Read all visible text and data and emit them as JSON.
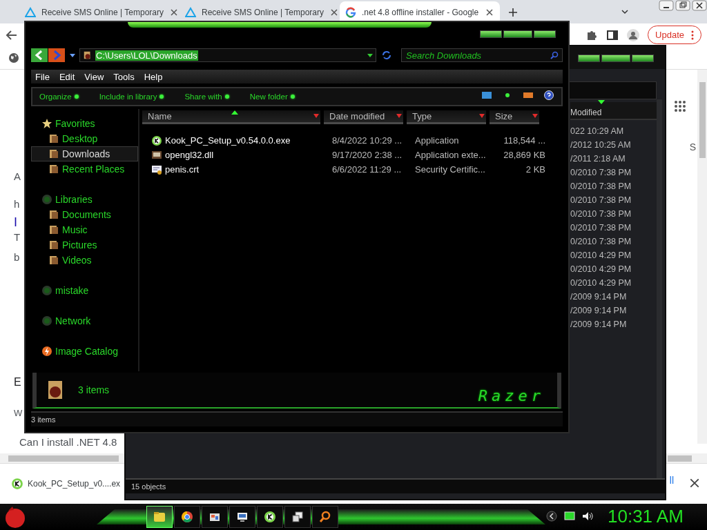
{
  "browser": {
    "tabs": [
      {
        "title": "Receive SMS Online | Temporary",
        "kind": "triangle",
        "selected": false
      },
      {
        "title": "Receive SMS Online | Temporary",
        "kind": "triangle",
        "selected": false
      },
      {
        "title": ".net 4.8 offline installer - Google",
        "kind": "google",
        "selected": true
      }
    ],
    "update_button": "Update",
    "page_lines": [
      {
        "text": "A",
        "kind": "text"
      },
      {
        "text": "h",
        "kind": "text"
      },
      {
        "text": "I",
        "kind": "link"
      },
      {
        "text": "T",
        "kind": "text"
      },
      {
        "text": "b",
        "kind": "text"
      },
      {
        "text": "E",
        "kind": "heading"
      },
      {
        "text": "W",
        "kind": "text"
      },
      {
        "text": "Can I install .NET 4.8",
        "kind": "text"
      }
    ],
    "side_fragment": "S",
    "download": {
      "filename": "Kook_PC_Setup_v0....ex",
      "button": "ll"
    }
  },
  "back_window": {
    "column": "Modified",
    "rows": [
      "022 10:29 AM",
      "/2012 10:25 AM",
      "/2011 2:18 AM",
      "0/2010 7:38 PM",
      "0/2010 7:38 PM",
      "0/2010 7:38 PM",
      "0/2010 7:38 PM",
      "0/2010 7:38 PM",
      "0/2010 7:38 PM",
      "0/2010 4:29 PM",
      "0/2010 4:29 PM",
      "0/2010 4:29 PM",
      "/2009 9:14 PM",
      "/2009 9:14 PM",
      "/2009 9:14 PM"
    ],
    "status": "15 objects"
  },
  "explorer": {
    "address": "C:\\Users\\LOL\\Downloads",
    "search": {
      "placeholder": "Search Downloads"
    },
    "menu": [
      "File",
      "Edit",
      "View",
      "Tools",
      "Help"
    ],
    "commands": [
      "Organize",
      "Include in library",
      "Share with",
      "New folder"
    ],
    "sidebar": [
      {
        "label": "Favorites",
        "kind": "star",
        "selected": false,
        "children": [
          {
            "label": "Desktop",
            "kind": "folder",
            "selected": false
          },
          {
            "label": "Downloads",
            "kind": "folder",
            "selected": true
          },
          {
            "label": "Recent Places",
            "kind": "folder",
            "selected": false
          }
        ]
      },
      {
        "label": "Libraries",
        "kind": "disc",
        "selected": false,
        "children": [
          {
            "label": "Documents",
            "kind": "folder",
            "selected": false
          },
          {
            "label": "Music",
            "kind": "folder",
            "selected": false
          },
          {
            "label": "Pictures",
            "kind": "folder",
            "selected": false
          },
          {
            "label": "Videos",
            "kind": "folder",
            "selected": false
          }
        ]
      },
      {
        "label": "mistake",
        "kind": "disc",
        "selected": false
      },
      {
        "label": "Network",
        "kind": "disc",
        "selected": false
      },
      {
        "label": "Image Catalog",
        "kind": "bolt",
        "selected": false
      }
    ],
    "columns": [
      {
        "label": "Name",
        "sorted": true
      },
      {
        "label": "Date modified",
        "sorted": false
      },
      {
        "label": "Type",
        "sorted": false
      },
      {
        "label": "Size",
        "sorted": false
      }
    ],
    "files": [
      {
        "name": "Kook_PC_Setup_v0.54.0.0.exe",
        "date": "8/4/2022 10:29 ...",
        "type": "Application",
        "size": "118,544 ...",
        "kind": "app"
      },
      {
        "name": "opengl32.dll",
        "date": "9/17/2020 2:38 ...",
        "type": "Application exte...",
        "size": "28,869 KB",
        "kind": "dll"
      },
      {
        "name": "penis.crt",
        "date": "6/6/2022 11:29 ...",
        "type": "Security Certific...",
        "size": "2 KB",
        "kind": "cert"
      }
    ],
    "details": {
      "count": "3 items",
      "logo": "Razer"
    },
    "status": "3 items"
  },
  "taskbar": {
    "items": [
      {
        "kind": "folder",
        "selected": true
      },
      {
        "kind": "browser",
        "selected": false
      },
      {
        "kind": "paint",
        "selected": false
      },
      {
        "kind": "screen",
        "selected": false
      },
      {
        "kind": "app",
        "selected": false
      },
      {
        "kind": "devices",
        "selected": false
      },
      {
        "kind": "search",
        "selected": false
      }
    ],
    "clock": "10:31 AM"
  }
}
